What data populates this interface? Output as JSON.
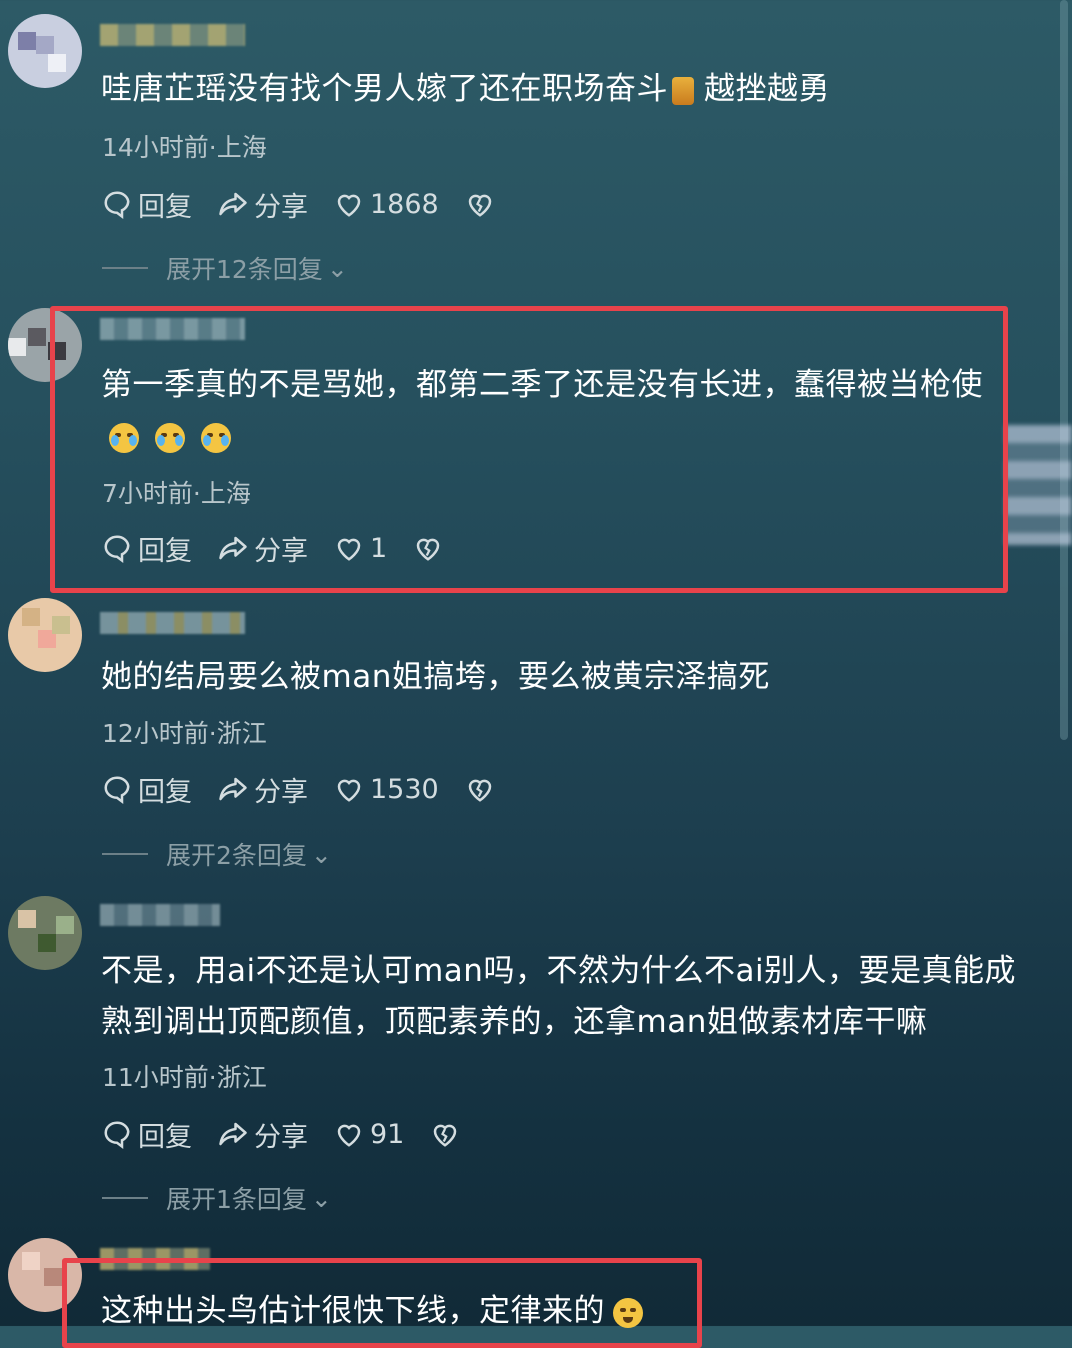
{
  "comments": [
    {
      "text_before": "哇唐芷瑶没有找个男人嫁了还在职场奋斗",
      "text_after": "越挫越勇",
      "meta": "14小时前·上海",
      "reply_label": "回复",
      "share_label": "分享",
      "likes": "1868",
      "expand": "展开12条回复"
    },
    {
      "text": "第一季真的不是骂她，都第二季了还是没有长进，蠢得被当枪使",
      "meta": "7小时前·上海",
      "reply_label": "回复",
      "share_label": "分享",
      "likes": "1"
    },
    {
      "text": "她的结局要么被man姐搞垮，要么被黄宗泽搞死",
      "meta": "12小时前·浙江",
      "reply_label": "回复",
      "share_label": "分享",
      "likes": "1530",
      "expand": "展开2条回复"
    },
    {
      "text": "不是，用ai不还是认可man吗，不然为什么不ai别人，要是真能成熟到调出顶配颜值，顶配素养的，还拿man姐做素材库干嘛",
      "meta": "11小时前·浙江",
      "reply_label": "回复",
      "share_label": "分享",
      "likes": "91",
      "expand": "展开1条回复"
    },
    {
      "text": "这种出头鸟估计很快下线，定律来的"
    }
  ],
  "colors": {
    "highlight": "#e8434b",
    "background_top": "#2d5a66",
    "background_bottom": "#112a37"
  }
}
